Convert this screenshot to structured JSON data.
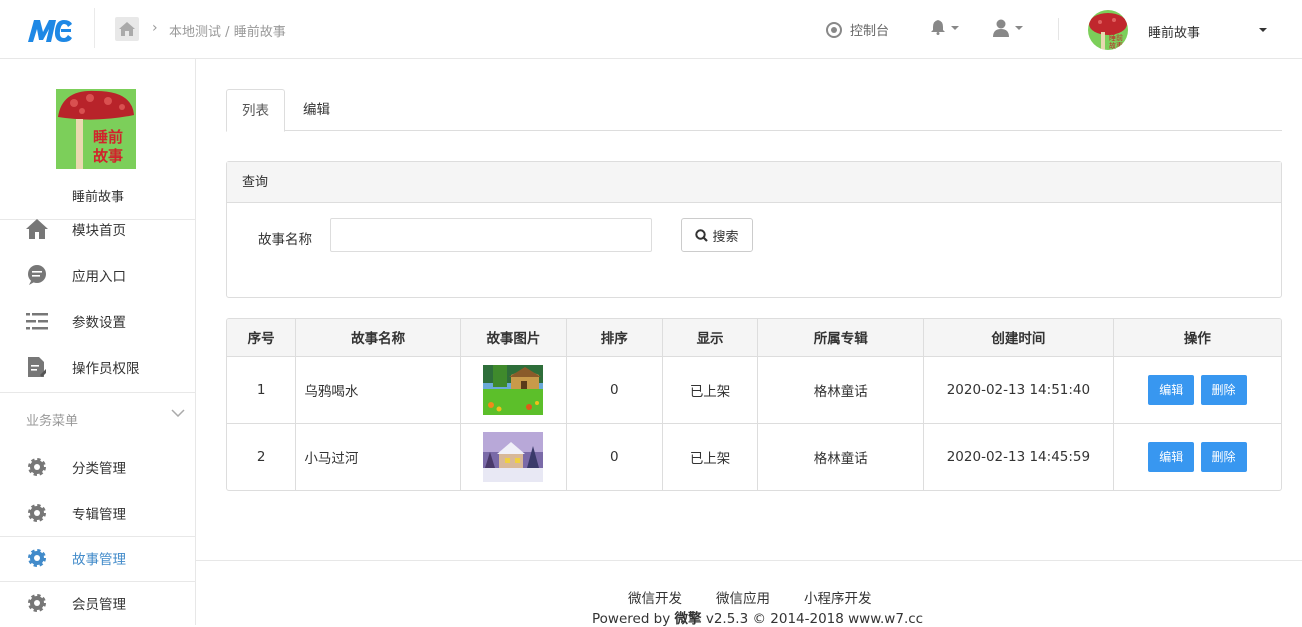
{
  "header": {
    "logo_text": "MC",
    "breadcrumb": [
      "本地测试",
      "睡前故事"
    ],
    "breadcrumb_sep": "/",
    "control_panel": "控制台",
    "account_name": "睡前故事"
  },
  "sidebar": {
    "app_name": "睡前故事",
    "logo_text_line1": "睡前",
    "logo_text_line2": "故事",
    "items": [
      {
        "label": "模块首页",
        "icon": "home-icon"
      },
      {
        "label": "应用入口",
        "icon": "chat-icon"
      },
      {
        "label": "参数设置",
        "icon": "list-settings-icon"
      },
      {
        "label": "操作员权限",
        "icon": "document-edit-icon"
      }
    ],
    "section_title": "业务菜单",
    "business_items": [
      {
        "label": "分类管理",
        "icon": "gear-icon",
        "active": false
      },
      {
        "label": "专辑管理",
        "icon": "gear-icon",
        "active": false
      },
      {
        "label": "故事管理",
        "icon": "gear-icon",
        "active": true
      },
      {
        "label": "会员管理",
        "icon": "gear-icon",
        "active": false
      }
    ]
  },
  "tabs": [
    {
      "label": "列表",
      "active": true
    },
    {
      "label": "编辑",
      "active": false
    }
  ],
  "query": {
    "title": "查询",
    "field_label": "故事名称",
    "field_value": "",
    "search_label": "搜索"
  },
  "table": {
    "columns": [
      "序号",
      "故事名称",
      "故事图片",
      "排序",
      "显示",
      "所属专辑",
      "创建时间",
      "操作"
    ],
    "rows": [
      {
        "no": "1",
        "name": "乌鸦喝水",
        "image": "cottage-spring-thumbnail",
        "sort": "0",
        "status": "已上架",
        "album": "格林童话",
        "created": "2020-02-13 14:51:40",
        "edit": "编辑",
        "delete": "删除"
      },
      {
        "no": "2",
        "name": "小马过河",
        "image": "cottage-winter-thumbnail",
        "sort": "0",
        "status": "已上架",
        "album": "格林童话",
        "created": "2020-02-13 14:45:59",
        "edit": "编辑",
        "delete": "删除"
      }
    ]
  },
  "footer": {
    "links": [
      "微信开发",
      "微信应用",
      "小程序开发"
    ],
    "powered_prefix": "Powered by ",
    "powered_brand": "微擎",
    "powered_suffix": " v2.5.3 © 2014-2018 www.w7.cc"
  },
  "colors": {
    "accent": "#3897f0",
    "active_nav": "#428bca"
  }
}
